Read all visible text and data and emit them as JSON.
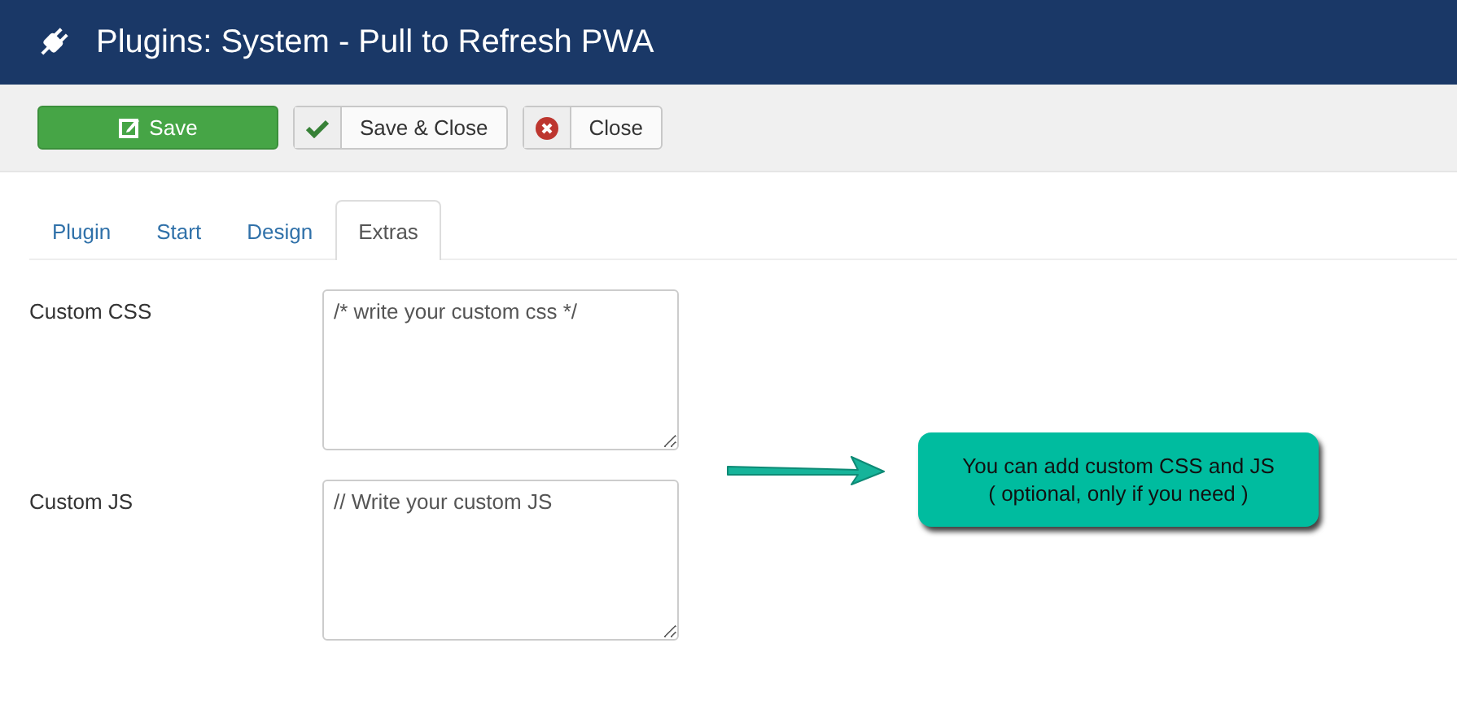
{
  "window": {
    "title": "Plugins: System - Pull to Refresh PWA"
  },
  "toolbar": [
    {
      "kind": "primary",
      "label": "Save"
    },
    {
      "kind": "confirm",
      "label": "Save & Close"
    },
    {
      "kind": "dismiss",
      "label": "Close"
    }
  ],
  "tabs": [
    {
      "label": "Plugin",
      "selected": false
    },
    {
      "label": "Start",
      "selected": false
    },
    {
      "label": "Design",
      "selected": false
    },
    {
      "label": "Extras",
      "selected": true
    }
  ],
  "fields": [
    {
      "label": "Custom CSS",
      "value": "/* write your custom css */"
    },
    {
      "label": "Custom JS",
      "value": "// Write your custom JS"
    }
  ],
  "callout": {
    "lines": [
      "You can add custom CSS and JS",
      "( optional, only if you need )"
    ]
  }
}
